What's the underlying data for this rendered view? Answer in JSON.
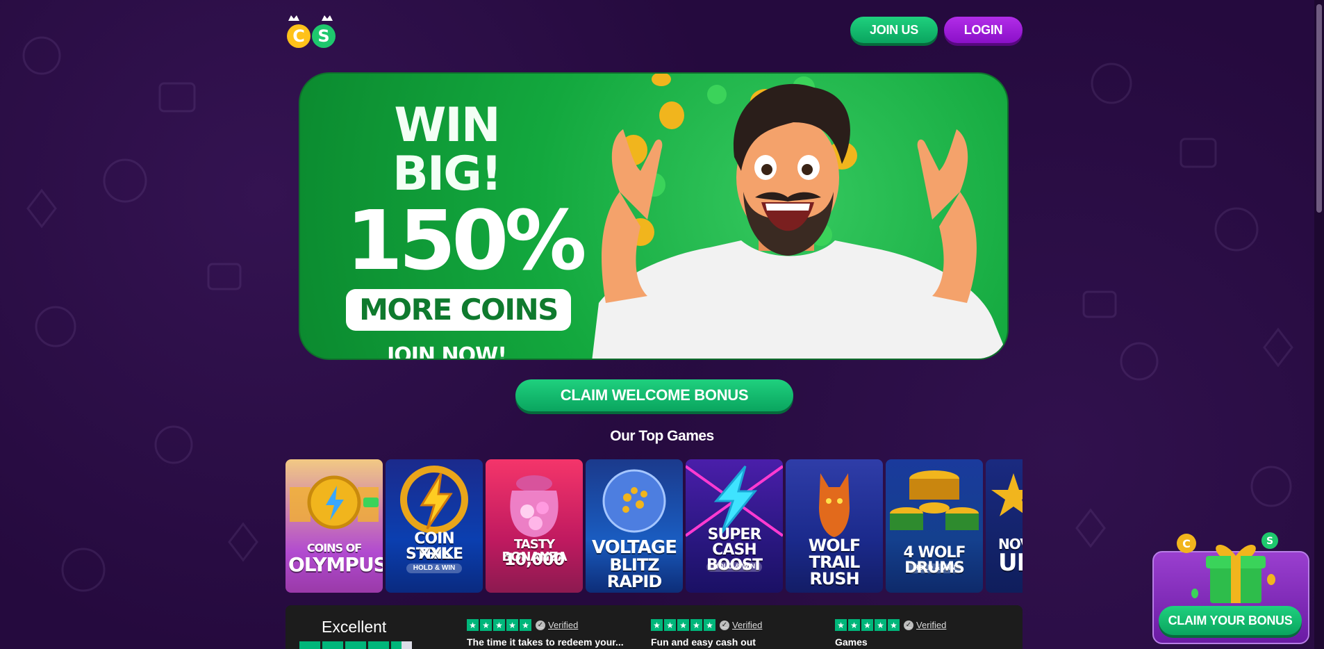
{
  "header": {
    "logo_letters": [
      "C",
      "S"
    ],
    "join_label": "JOIN US",
    "login_label": "LOGIN"
  },
  "banner": {
    "headline": "WIN BIG!",
    "percent": "150%",
    "pill": "MORE COINS",
    "cta": "JOIN NOW!"
  },
  "claim_welcome_label": "CLAIM WELCOME BONUS",
  "top_games": {
    "title": "Our Top Games",
    "games": [
      {
        "line1": "COINS OF",
        "line2": "OLYMPUS",
        "tag": ""
      },
      {
        "line1": "COIN STRIKE",
        "line2": "XXL",
        "tag": "HOLD & WIN"
      },
      {
        "line1": "TASTY BONANZA",
        "line2": "10,000",
        "tag": ""
      },
      {
        "line1": "VOLTAGE",
        "line2": "BLITZ RAPID",
        "tag": ""
      },
      {
        "line1": "SUPER",
        "line2": "CASH BOOST",
        "tag": "HOLD & WIN"
      },
      {
        "line1": "WOLF",
        "line2": "TRAIL RUSH",
        "tag": ""
      },
      {
        "line1": "4 WOLF DRUMS",
        "line2": "",
        "tag": "HOLD & WIN"
      },
      {
        "line1": "NOV",
        "line2": "UL",
        "tag": ""
      }
    ]
  },
  "reviews": {
    "rating_word": "Excellent",
    "verified_label": "Verified",
    "items": [
      {
        "text": "The time it takes to redeem your..."
      },
      {
        "text": "Fun and easy cash out"
      },
      {
        "text": "Games"
      }
    ]
  },
  "bonus_widget": {
    "label": "CLAIM YOUR BONUS",
    "coin_letters": [
      "C",
      "S"
    ]
  },
  "colors": {
    "background": "#250a3e",
    "green": "#0aa55f",
    "purple": "#8a10c8",
    "trustpilot_green": "#00b67a"
  }
}
